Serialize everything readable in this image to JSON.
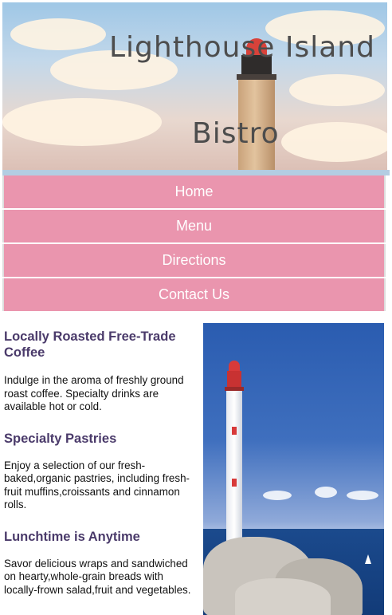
{
  "header": {
    "title_line1": "Lighthouse Island",
    "title_line2": "Bistro"
  },
  "nav": {
    "items": [
      {
        "label": "Home"
      },
      {
        "label": "Menu"
      },
      {
        "label": "Directions"
      },
      {
        "label": "Contact Us"
      }
    ]
  },
  "sections": [
    {
      "heading": "Locally Roasted Free-Trade Coffee",
      "text": "Indulge in the aroma of freshly ground roast coffee. Specialty drinks are available hot or cold."
    },
    {
      "heading": "Specialty Pastries",
      "text": "Enjoy a selection of our fresh-baked,organic pastries, including fresh-fruit muffins,croissants and cinnamon rolls."
    },
    {
      "heading": "Lunchtime is Anytime",
      "text": "Savor delicious wraps and sandwiched on hearty,whole-grain breads with locally-frown salad,fruit and vegetables."
    }
  ],
  "colors": {
    "nav_background": "#ea95ae",
    "nav_text": "#ffffff",
    "heading_text": "#4a3a6a",
    "band": "#b3cde2"
  },
  "images": {
    "header_photo": "lighthouse-sunset-photo",
    "side_photo": "lighthouse-coast-photo"
  }
}
